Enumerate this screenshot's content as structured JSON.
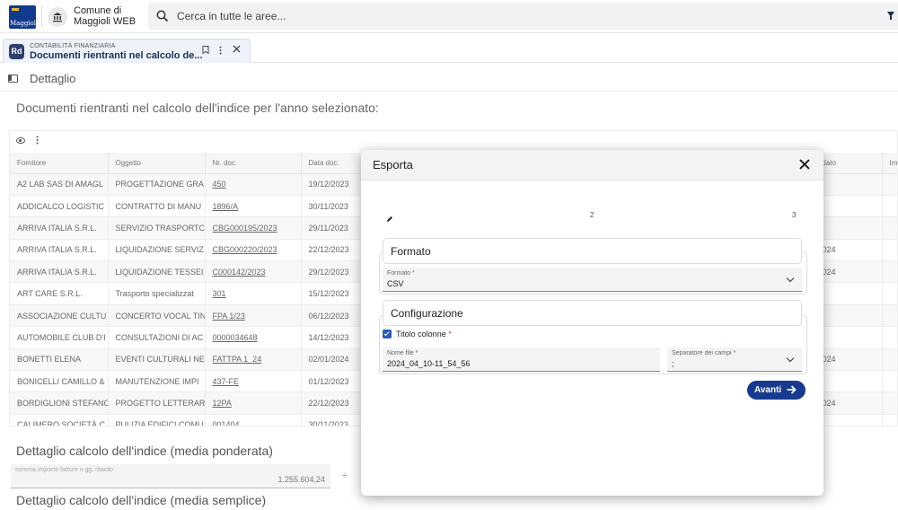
{
  "header": {
    "logo_text": "Maggioli",
    "comune_line1": "Comune di",
    "comune_line2": "Maggioli WEB",
    "search_placeholder": "Cerca in tutte le aree..."
  },
  "tab": {
    "badge": "Rd",
    "category": "CONTABILITÀ FINANZIARIA",
    "title": "Documenti rientranti nel calcolo de..."
  },
  "page": {
    "section_label": "Dettaglio",
    "title": "Documenti rientranti nel calcolo dell'indice per l'anno selezionato:"
  },
  "grid": {
    "columns": [
      "Fornitore",
      "Oggetto",
      "Nr. doc.",
      "Data doc.",
      "",
      "",
      "",
      "",
      "dato",
      "Im"
    ],
    "rows": [
      {
        "fornitore": "A2 LAB SAS DI AMAGL",
        "oggetto": "PROGETTAZIONE GRA",
        "nr": "450",
        "data": "19/12/2023",
        "extra": ""
      },
      {
        "fornitore": "ADDICALCO LOGISTIC",
        "oggetto": "CONTRATTO DI MANU",
        "nr": "1896/A",
        "data": "30/11/2023",
        "extra": ""
      },
      {
        "fornitore": "ARRIVA ITALIA S.R.L.",
        "oggetto": "SERVIZIO TRASPORTC",
        "nr": "CBG000195/2023",
        "data": "29/11/2023",
        "extra": ""
      },
      {
        "fornitore": "ARRIVA ITALIA S.R.L.",
        "oggetto": "LIQUIDAZIONE SERVIZ",
        "nr": "CBG000220/2023",
        "data": "22/12/2023",
        "extra": "024"
      },
      {
        "fornitore": "ARRIVA ITALIA S.R.L.",
        "oggetto": "LIQUIDAZIONE TESSEI",
        "nr": "C000142/2023",
        "data": "29/12/2023",
        "extra": "024"
      },
      {
        "fornitore": "ART CARE S.R.L.",
        "oggetto": "Trasporto specializzat",
        "nr": "301",
        "data": "15/12/2023",
        "extra": ""
      },
      {
        "fornitore": "ASSOCIAZIONE CULTU",
        "oggetto": "CONCERTO VOCAL TIN",
        "nr": "FPA 1/23",
        "data": "06/12/2023",
        "extra": ""
      },
      {
        "fornitore": "AUTOMOBILE CLUB D'I",
        "oggetto": "CONSULTAZIONI DI AC",
        "nr": "0000034648",
        "data": "14/12/2023",
        "extra": ""
      },
      {
        "fornitore": "BONETTI ELENA",
        "oggetto": "EVENTI CULTURALI NE",
        "nr": "FATTPA 1_24",
        "data": "02/01/2024",
        "extra": "024"
      },
      {
        "fornitore": "BONICELLI CAMILLO &",
        "oggetto": "MANUTENZIONE IMPI",
        "nr": "437-FE",
        "data": "01/12/2023",
        "extra": ""
      },
      {
        "fornitore": "BORDIGLIONI STEFANO",
        "oggetto": "PROGETTO LETTERAR",
        "nr": "12PA",
        "data": "22/12/2023",
        "extra": "024"
      },
      {
        "fornitore": "CALIMERO SOCIETÀ C",
        "oggetto": "PULIZIA EDIFICI COMU",
        "nr": "001404",
        "data": "30/11/2023",
        "extra": ""
      }
    ]
  },
  "bottom": {
    "media_ponderata_title": "Dettaglio calcolo dell'indice (media ponderata)",
    "field_label": "somma importo fatture x gg. ritardo",
    "field_value": "1.255.604,24",
    "divide_symbol": "÷",
    "media_semplice_title": "Dettaglio calcolo dell'indice (media semplice)"
  },
  "modal": {
    "title": "Esporta",
    "steps": [
      "2",
      "3"
    ],
    "formato_header": "Formato",
    "formato_label": "Formato",
    "formato_value": "CSV",
    "config_header": "Configurazione",
    "titolo_colonne_label": "Titolo colonne",
    "nome_file_label": "Nome file",
    "nome_file_value": "2024_04_10-11_54_56",
    "separatore_label": "Separatore dei campi",
    "separatore_value": ";",
    "required_mark": "*",
    "next_button": "Avanti"
  },
  "colors": {
    "primary": "#173a8e",
    "tab_badge": "#2d3f6e",
    "checkbox": "#2a5bb5",
    "required": "#d32f2f"
  }
}
